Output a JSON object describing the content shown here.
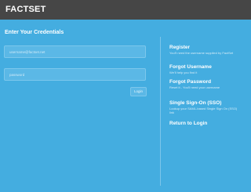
{
  "header": {
    "logo_text": "FACTSET"
  },
  "form": {
    "heading": "Enter Your Credentials",
    "username": {
      "value": "",
      "placeholder": "username@factset.net"
    },
    "password": {
      "value": "",
      "placeholder": "password"
    },
    "login_label": "Login"
  },
  "sidebar": {
    "register_title": "Register",
    "register_desc": "You'll need the username supplied by FactSet",
    "forgot_username_title": "Forgot Username",
    "forgot_username_desc": "We'll help you find it",
    "forgot_password_title": "Forgot Password",
    "forgot_password_desc": "Reset it - You'll need your username",
    "sso_title": "Single Sign-On (SSO)",
    "sso_desc": "Lookup your SAML-based Single Sign On (SSO) link",
    "return_title": "Return to Login"
  },
  "colors": {
    "background": "#44ade0",
    "topbar": "#464646",
    "text": "#ffffff"
  }
}
